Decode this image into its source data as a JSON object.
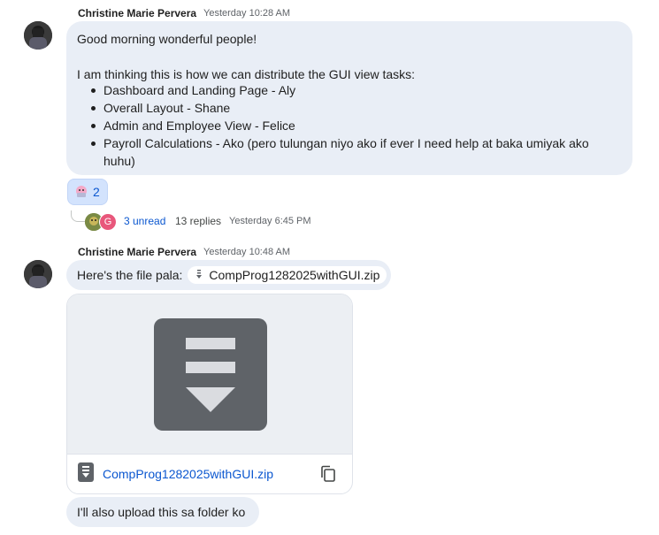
{
  "messages": [
    {
      "sender": "Christine Marie Pervera",
      "time": "Yesterday 10:28 AM",
      "greeting": "Good morning wonderful people!",
      "intro": "I am thinking this is how we can distribute the GUI view tasks:",
      "tasks": [
        "Dashboard and Landing Page - Aly",
        "Overall Layout - Shane",
        "Admin and Employee View - Felice",
        "Payroll Calculations - Ako (pero tulungan niyo ako if ever I need help at baka umiyak ako",
        "huhu)"
      ],
      "reaction": {
        "emoji_icon": "pink-creature-emoji-icon",
        "count": "2"
      },
      "thread": {
        "avatar_letter": "G",
        "unread": "3 unread",
        "replies": "13 replies",
        "last_reply": "Yesterday 6:45 PM"
      }
    },
    {
      "sender": "Christine Marie Pervera",
      "time": "Yesterday 10:48 AM",
      "text": "Here's the file pala:",
      "chip_file": "CompProg1282025withGUI.zip",
      "attachment_name": "CompProg1282025withGUI.zip",
      "followup": "I'll also upload this sa folder ko"
    }
  ],
  "colors": {
    "bubble": "#e9eef6",
    "link": "#0b57d0",
    "zip_icon": "#5f6368"
  }
}
